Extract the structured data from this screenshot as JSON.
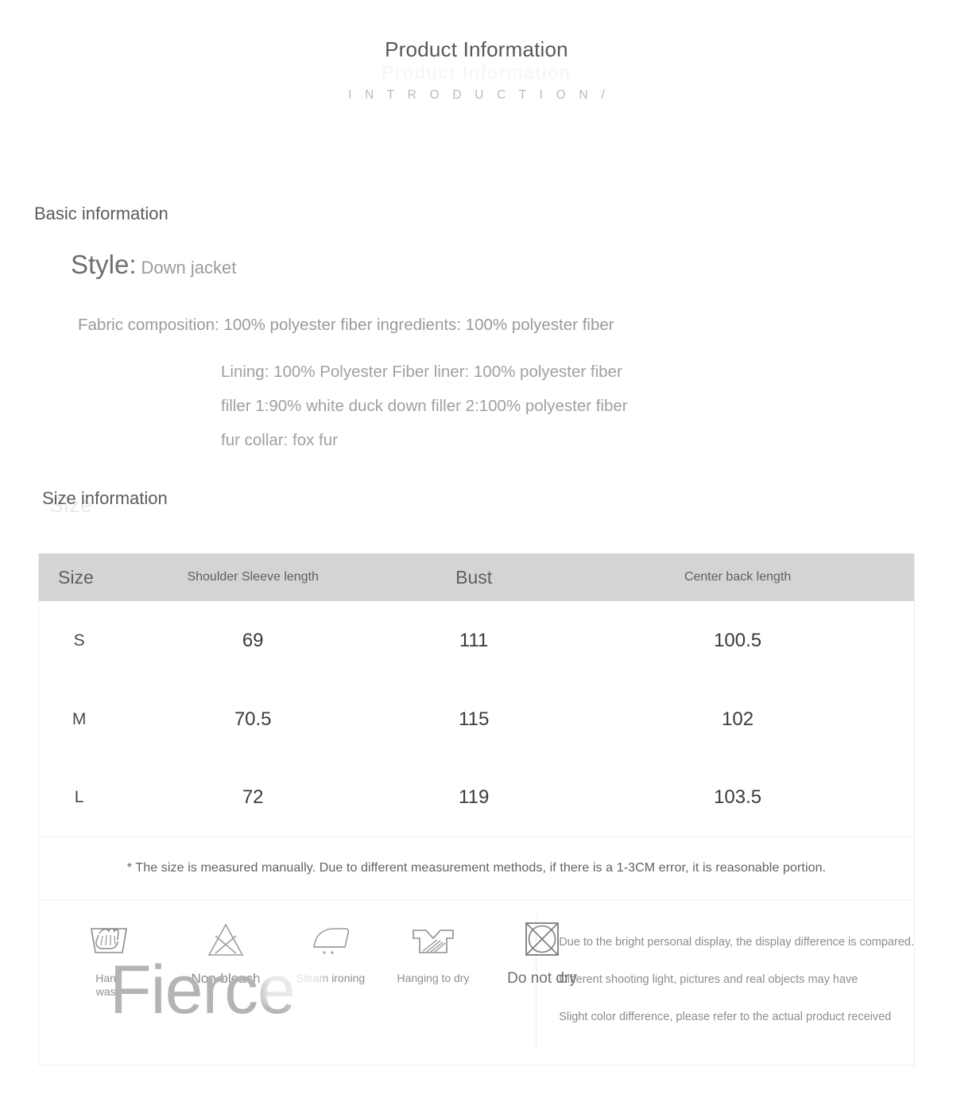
{
  "header": {
    "title": "Product Information",
    "subtitle": "I N T R O D U C T I O N /"
  },
  "basic": {
    "section_title": "Basic information",
    "style_key": "Style:",
    "style_value": "Down jacket",
    "fabric_line": "Fabric composition: 100% polyester fiber ingredients: 100% polyester fiber",
    "composition": [
      "Lining: 100% Polyester Fiber liner: 100% polyester fiber",
      "filler 1:90% white duck down filler 2:100% polyester fiber",
      "fur collar: fox fur"
    ]
  },
  "size": {
    "section_title": "Size information",
    "columns": [
      "Size",
      "Shoulder Sleeve length",
      "Bust",
      "Center back length"
    ],
    "rows": [
      {
        "size": "S",
        "shoulder_sleeve_length": "69",
        "bust": "111",
        "center_back_length": "100.5"
      },
      {
        "size": "M",
        "shoulder_sleeve_length": "70.5",
        "bust": "115",
        "center_back_length": "102"
      },
      {
        "size": "L",
        "shoulder_sleeve_length": "72",
        "bust": "119",
        "center_back_length": "103.5"
      }
    ],
    "note": "* The size is measured manually. Due to different measurement methods, if there is a 1-3CM error, it is reasonable portion."
  },
  "care": {
    "items": [
      {
        "label": "Hand\nwash",
        "icon": "hand-wash-icon"
      },
      {
        "label": "Non-bleach",
        "icon": "non-bleach-icon"
      },
      {
        "label": "Steam ironing",
        "icon": "steam-iron-icon"
      },
      {
        "label": "Hanging to dry",
        "icon": "hang-dry-icon"
      },
      {
        "label": "Do not dry",
        "icon": "do-not-tumble-dry-icon"
      }
    ],
    "labels": {
      "hand_wash_l1": "Hand",
      "hand_wash_l2": "wash",
      "non_bleach": "Non-bleach",
      "steam_ironing": "Steam ironing",
      "hanging_to_dry": "Hanging to dry",
      "do_not_dry": "Do not dry"
    }
  },
  "disclaimer": {
    "lines": [
      "Due to the bright personal display, the display difference is compared.",
      "Different shooting light, pictures and real objects may have",
      "Slight color difference, please refer to the actual product received"
    ]
  },
  "watermark": {
    "text": "Fierce"
  },
  "colors": {
    "table_header_bg": "#d4d4d4",
    "border": "#eeeeee",
    "title_text": "#575757",
    "muted_text": "#9a9a9a",
    "watermark": "#b4b4b4"
  }
}
